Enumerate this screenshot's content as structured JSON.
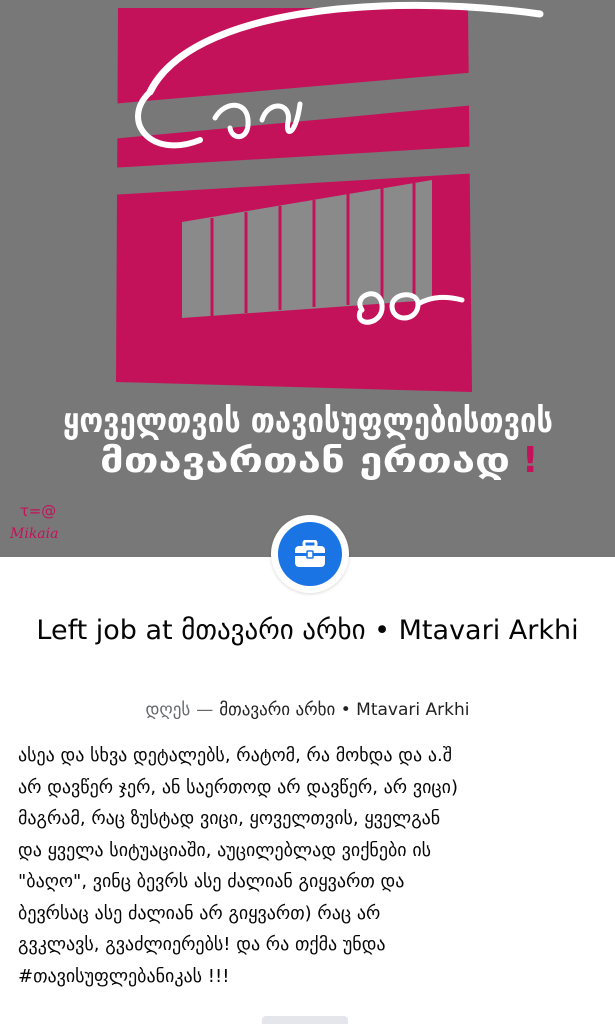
{
  "cover": {
    "poster_line_1": "ყოველთვის თავისუფლებისთვის",
    "poster_line_2": "მთავართან ერთად",
    "poster_exclaim": "!",
    "signature": "Mikaia",
    "colors": {
      "background": "#787878",
      "magenta": "#c4125a",
      "stroke": "#ffffff"
    }
  },
  "badge": {
    "icon": "briefcase-icon",
    "color": "#1b74e4"
  },
  "event": {
    "title": "Left job at მთავარი არხი • Mtavari Arkhi",
    "when": "დღეს",
    "separator": "—",
    "source": "მთავარი არხი • Mtavari Arkhi"
  },
  "post": {
    "lines": [
      "ასეა და სხვა დეტალებს, რატომ, რა მოხდა და ა.შ",
      "არ დავწერ ჯერ, ან საერთოდ არ დავწერ, არ ვიცი)",
      "მაგრამ, რაც ზუსტად ვიცი, ყოველთვის, ყველგან",
      "და ყველა სიტუაციაში, აუცილებლად ვიქნები ის",
      "\"ბაღო\", ვინც ბევრს  ასე ძალიან გიყვართ და",
      "ბევრსაც ასე ძალიან არ გიყვართ) რაც არ",
      "გვკლავს, გვაძლიერებს! და რა თქმა უნდა",
      "#თავისუფლებანიკას !!!"
    ]
  }
}
